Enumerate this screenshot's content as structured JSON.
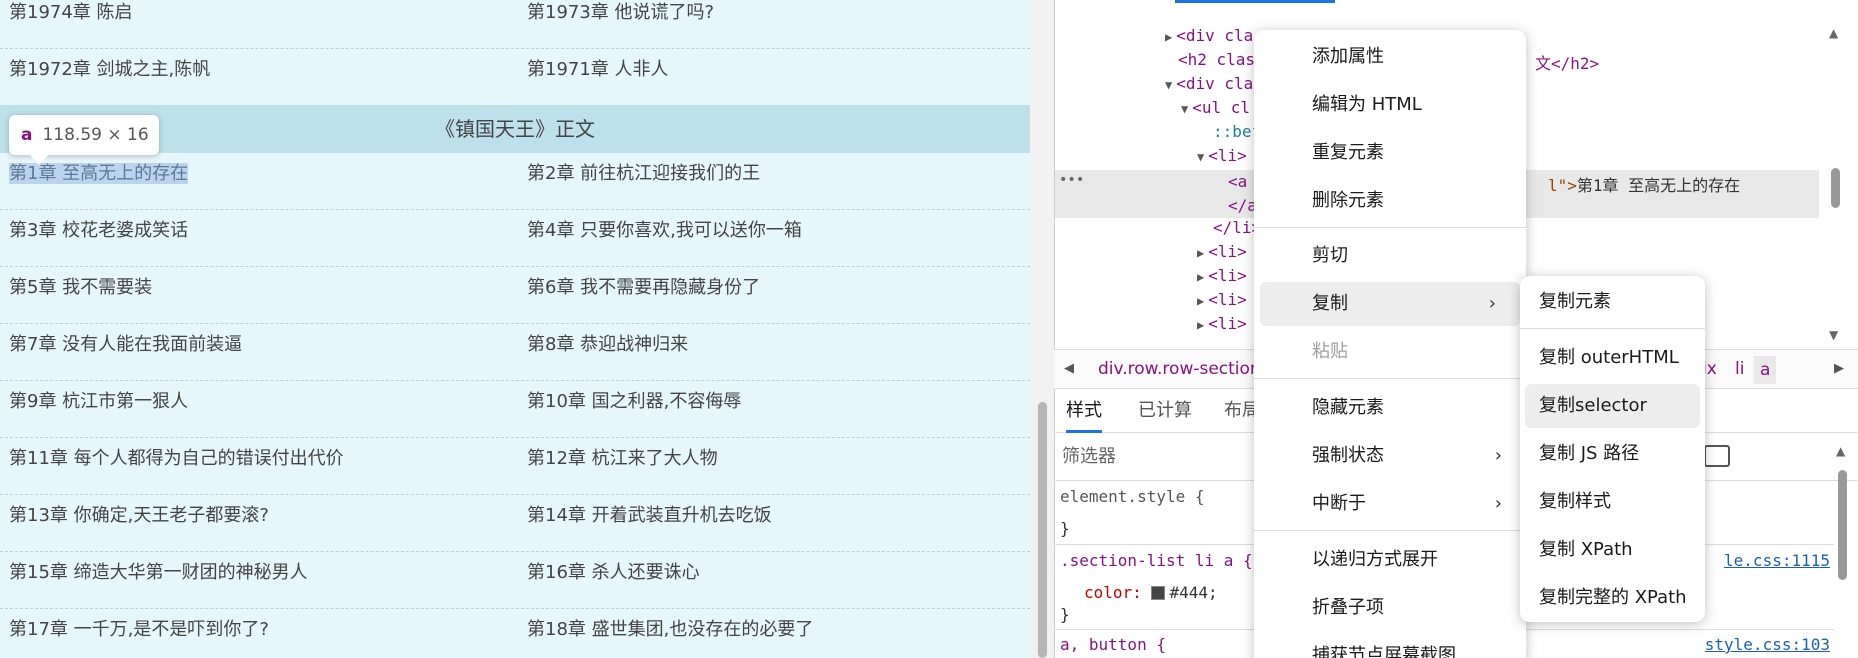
{
  "page": {
    "rows": [
      {
        "left": "第1974章 陈启",
        "right": "第1973章 他说谎了吗?"
      },
      {
        "left": "第1972章 剑城之主,陈帆",
        "right": "第1971章 人非人"
      }
    ],
    "section_header": "《镇国天王》正文",
    "chapter_rows": [
      {
        "left": "第1章 至高无上的存在",
        "right": "第2章 前往杭江迎接我们的王"
      },
      {
        "left": "第3章 校花老婆成笑话",
        "right": "第4章 只要你喜欢,我可以送你一箱"
      },
      {
        "left": "第5章 我不需要装",
        "right": "第6章 我不需要再隐藏身份了"
      },
      {
        "left": "第7章 没有人能在我面前装逼",
        "right": "第8章 恭迎战神归来"
      },
      {
        "left": "第9章 杭江市第一狠人",
        "right": "第10章 国之利器,不容侮辱"
      },
      {
        "left": "第11章 每个人都得为自己的错误付出代价",
        "right": "第12章 杭江来了大人物"
      },
      {
        "left": "第13章 你确定,天王老子都要滚?",
        "right": "第14章 开着武装直升机去吃饭"
      },
      {
        "left": "第15章 缔造大华第一财团的神秘男人",
        "right": "第16章 杀人还要诛心"
      },
      {
        "left": "第17章 一千万,是不是吓到你了?",
        "right": "第18章 盛世集团,也没存在的必要了"
      }
    ],
    "tooltip": {
      "tag": "a",
      "size": "118.59 × 16"
    }
  },
  "devtools": {
    "dom_lines": [
      {
        "text": "<div cla",
        "tri": "▶"
      },
      {
        "text": "<h2 clas",
        "tri": "",
        "suffix": "文</h2>"
      },
      {
        "text": "<div cla",
        "tri": "▼"
      },
      {
        "text": "<ul cl",
        "tri": "▼"
      },
      {
        "text": "::bef",
        "tri": ""
      },
      {
        "text": "<li>",
        "tri": "▼"
      },
      {
        "text": "<a",
        "tri": "",
        "attr_tail": "l\">",
        "content": "第1章 至高无上的存在"
      },
      {
        "text": "</a",
        "tri": ""
      },
      {
        "text": "</li>",
        "tri": ""
      },
      {
        "text": "<li>",
        "tri": "▶"
      },
      {
        "text": "<li>",
        "tri": "▶"
      },
      {
        "text": "<li>",
        "tri": "▶"
      },
      {
        "text": "<li>",
        "tri": "▶"
      }
    ],
    "breadcrumbs": {
      "left": "div.row.row-section",
      "right_items": [
        "t.fix",
        "li",
        "a"
      ]
    },
    "tabs": [
      "样式",
      "已计算",
      "布局"
    ],
    "filter_placeholder": "筛选器",
    "styles": {
      "element_style": "element.style {",
      "close_brace": "}",
      "rule_selector": ".section-list li a {",
      "rule_source": "le.css:1115",
      "color_prop": "color:",
      "color_value": "#444;",
      "rule2_selector": "a, button {",
      "rule2_source": "style.css:103"
    }
  },
  "context_menu": {
    "items": [
      {
        "label": "添加属性"
      },
      {
        "label": "编辑为 HTML"
      },
      {
        "label": "重复元素"
      },
      {
        "label": "删除元素"
      },
      {
        "label": "剪切"
      },
      {
        "label": "复制",
        "submenu": true
      },
      {
        "label": "粘贴",
        "disabled": true
      },
      {
        "label": "隐藏元素"
      },
      {
        "label": "强制状态",
        "submenu": true
      },
      {
        "label": "中断于",
        "submenu": true
      },
      {
        "label": "以递归方式展开"
      },
      {
        "label": "折叠子项"
      },
      {
        "label": "捕获节点屏幕截图"
      }
    ],
    "submenu_items": [
      {
        "label": "复制元素"
      },
      {
        "label": "复制 outerHTML"
      },
      {
        "label": "复制selector"
      },
      {
        "label": "复制 JS 路径"
      },
      {
        "label": "复制样式"
      },
      {
        "label": "复制 XPath"
      },
      {
        "label": "复制完整的 XPath"
      }
    ]
  }
}
